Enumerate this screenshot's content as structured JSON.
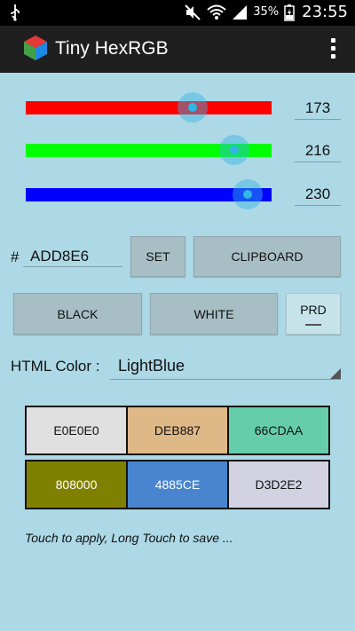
{
  "status_bar": {
    "battery_percent": "35%",
    "time": "23:55"
  },
  "action_bar": {
    "title": "Tiny HexRGB"
  },
  "sliders": [
    {
      "name": "red",
      "color": "#ff0000",
      "value": 173,
      "display": "173"
    },
    {
      "name": "green",
      "color": "#00ff00",
      "value": 216,
      "display": "216"
    },
    {
      "name": "blue",
      "color": "#0000ff",
      "value": 230,
      "display": "230"
    }
  ],
  "hex": {
    "prefix": "#",
    "value": "ADD8E6",
    "set_label": "SET",
    "clipboard_label": "CLIPBOARD"
  },
  "preset_buttons": {
    "black": "BLACK",
    "white": "WHITE",
    "prd": "PRD"
  },
  "html_color": {
    "label": "HTML Color :",
    "selected": "LightBlue"
  },
  "swatches": [
    [
      {
        "label": "E0E0E0",
        "bg": "#e0e0e0",
        "fg": "#111111"
      },
      {
        "label": "DEB887",
        "bg": "#deb887",
        "fg": "#111111"
      },
      {
        "label": "66CDAA",
        "bg": "#66cdaa",
        "fg": "#111111"
      }
    ],
    [
      {
        "label": "808000",
        "bg": "#808000",
        "fg": "#ffffff"
      },
      {
        "label": "4885CE",
        "bg": "#4885ce",
        "fg": "#ffffff"
      },
      {
        "label": "D3D2E2",
        "bg": "#d3d2e2",
        "fg": "#111111"
      }
    ]
  ],
  "hint": "Touch to apply, Long Touch to save ..."
}
